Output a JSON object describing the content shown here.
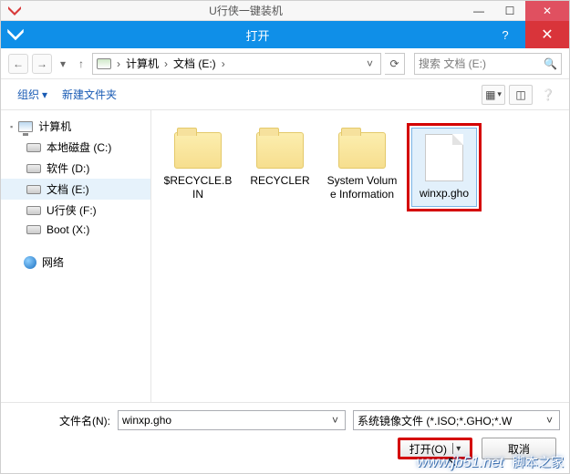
{
  "parent_window": {
    "title": "U行侠一键装机"
  },
  "dialog": {
    "title": "打开"
  },
  "breadcrumb": {
    "root": "计算机",
    "location": "文档 (E:)"
  },
  "search": {
    "placeholder": "搜索 文档 (E:)"
  },
  "toolbar": {
    "organize": "组织",
    "newfolder": "新建文件夹"
  },
  "nav": {
    "computer": "计算机",
    "drives": [
      {
        "label": "本地磁盘 (C:)"
      },
      {
        "label": "软件 (D:)"
      },
      {
        "label": "文档 (E:)"
      },
      {
        "label": "U行侠 (F:)"
      },
      {
        "label": "Boot (X:)"
      }
    ],
    "network": "网络"
  },
  "files": [
    {
      "name": "$RECYCLE.BIN",
      "kind": "folder"
    },
    {
      "name": "RECYCLER",
      "kind": "folder"
    },
    {
      "name": "System Volume Information",
      "kind": "folder"
    },
    {
      "name": "winxp.gho",
      "kind": "file",
      "selected": true
    }
  ],
  "footer": {
    "filename_label": "文件名(N):",
    "filename_value": "winxp.gho",
    "filter_value": "系统镜像文件 (*.ISO;*.GHO;*.W",
    "open_label": "打开(O)",
    "cancel_label": "取消"
  },
  "watermark": {
    "url": "www.jb51.net",
    "cn": "脚本之家"
  }
}
